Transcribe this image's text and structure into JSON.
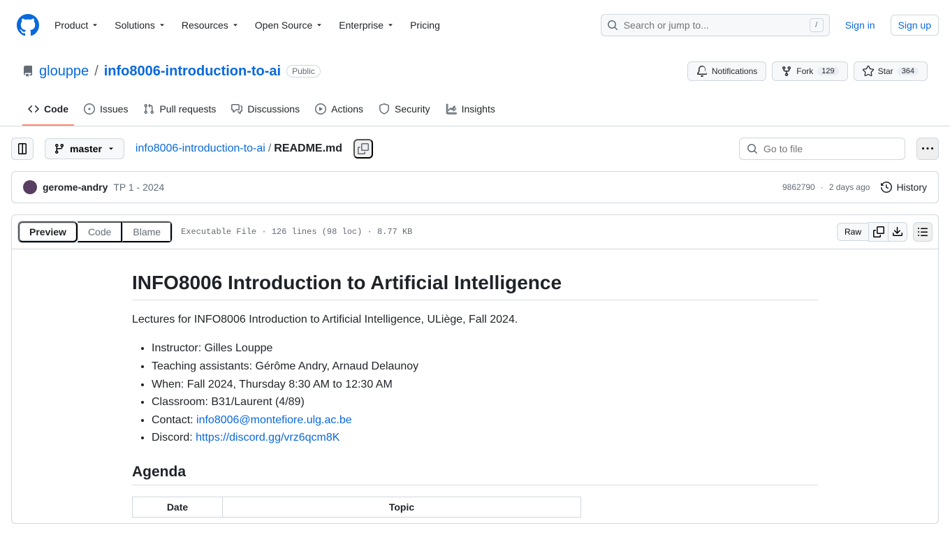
{
  "header": {
    "nav": [
      "Product",
      "Solutions",
      "Resources",
      "Open Source",
      "Enterprise"
    ],
    "nav_plain": "Pricing",
    "search_placeholder": "Search or jump to...",
    "slash": "/",
    "sign_in": "Sign in",
    "sign_up": "Sign up"
  },
  "repo": {
    "owner": "glouppe",
    "name": "info8006-introduction-to-ai",
    "visibility": "Public",
    "actions": {
      "notifications": "Notifications",
      "fork": "Fork",
      "fork_count": "129",
      "star": "Star",
      "star_count": "364"
    }
  },
  "tabs": {
    "code": "Code",
    "issues": "Issues",
    "pr": "Pull requests",
    "discussions": "Discussions",
    "actions": "Actions",
    "security": "Security",
    "insights": "Insights"
  },
  "toolbar": {
    "branch": "master",
    "bc_root": "info8006-introduction-to-ai",
    "bc_file": "README.md",
    "go_to_file": "Go to file"
  },
  "commit": {
    "author": "gerome-andry",
    "message": "TP 1 - 2024",
    "sha": "9862790",
    "sep": " · ",
    "date": "2 days ago",
    "history": "History"
  },
  "fileview": {
    "preview": "Preview",
    "code": "Code",
    "blame": "Blame",
    "meta": "Executable File  ·  126 lines (98 loc)  ·  8.77 KB",
    "raw": "Raw"
  },
  "readme": {
    "h1": "INFO8006 Introduction to Artificial Intelligence",
    "intro": "Lectures for INFO8006 Introduction to Artificial Intelligence, ULiège, Fall 2024.",
    "li1": "Instructor: Gilles Louppe",
    "li2": "Teaching assistants: Gérôme Andry, Arnaud Delaunoy",
    "li3": "When: Fall 2024, Thursday 8:30 AM to 12:30 AM",
    "li4": "Classroom: B31/Laurent (4/89)",
    "li5a": "Contact: ",
    "li5b": "info8006@montefiore.ulg.ac.be",
    "li6a": "Discord: ",
    "li6b": "https://discord.gg/vrz6qcm8K",
    "h2": "Agenda",
    "th1": "Date",
    "th2": "Topic"
  }
}
